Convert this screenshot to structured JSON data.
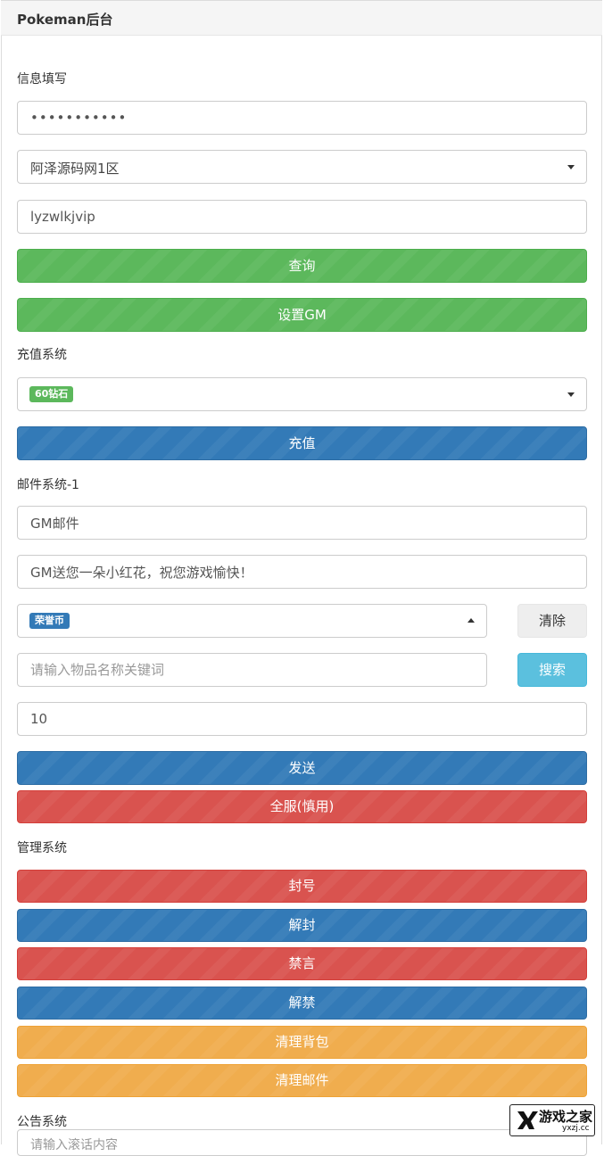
{
  "header": {
    "title": "Pokeman后台"
  },
  "info": {
    "section_label": "信息填写",
    "password_value": "•••••••••••",
    "server_select": "阿泽源码网1区",
    "account_value": "lyzwlkjvip",
    "query_button": "查询",
    "set_gm_button": "设置GM"
  },
  "recharge": {
    "section_label": "充值系统",
    "selected_tag": "60钻石",
    "recharge_button": "充值"
  },
  "mail": {
    "section_label": "邮件系统-1",
    "title_value": "GM邮件",
    "content_value": "GM送您一朵小红花，祝您游戏愉快！",
    "item_tag": "荣誉币",
    "clear_button": "清除",
    "search_placeholder": "请输入物品名称关键词",
    "search_button": "搜索",
    "quantity_value": "10",
    "send_button": "发送",
    "send_all_button": "全服(慎用)"
  },
  "manage": {
    "section_label": "管理系统",
    "buttons": [
      "封号",
      "解封",
      "禁言",
      "解禁",
      "清理背包",
      "清理邮件"
    ]
  },
  "notice": {
    "section_label": "公告系统",
    "input_placeholder": "请输入滚话内容"
  },
  "watermark": {
    "title": "游戏之家",
    "url": "yxzj.cc"
  },
  "colors": {
    "green": "#5cb85c",
    "blue": "#337ab7",
    "red": "#d9534f",
    "orange": "#f0ad4e",
    "cyan": "#5bc0de",
    "gray": "#eeeeee"
  }
}
